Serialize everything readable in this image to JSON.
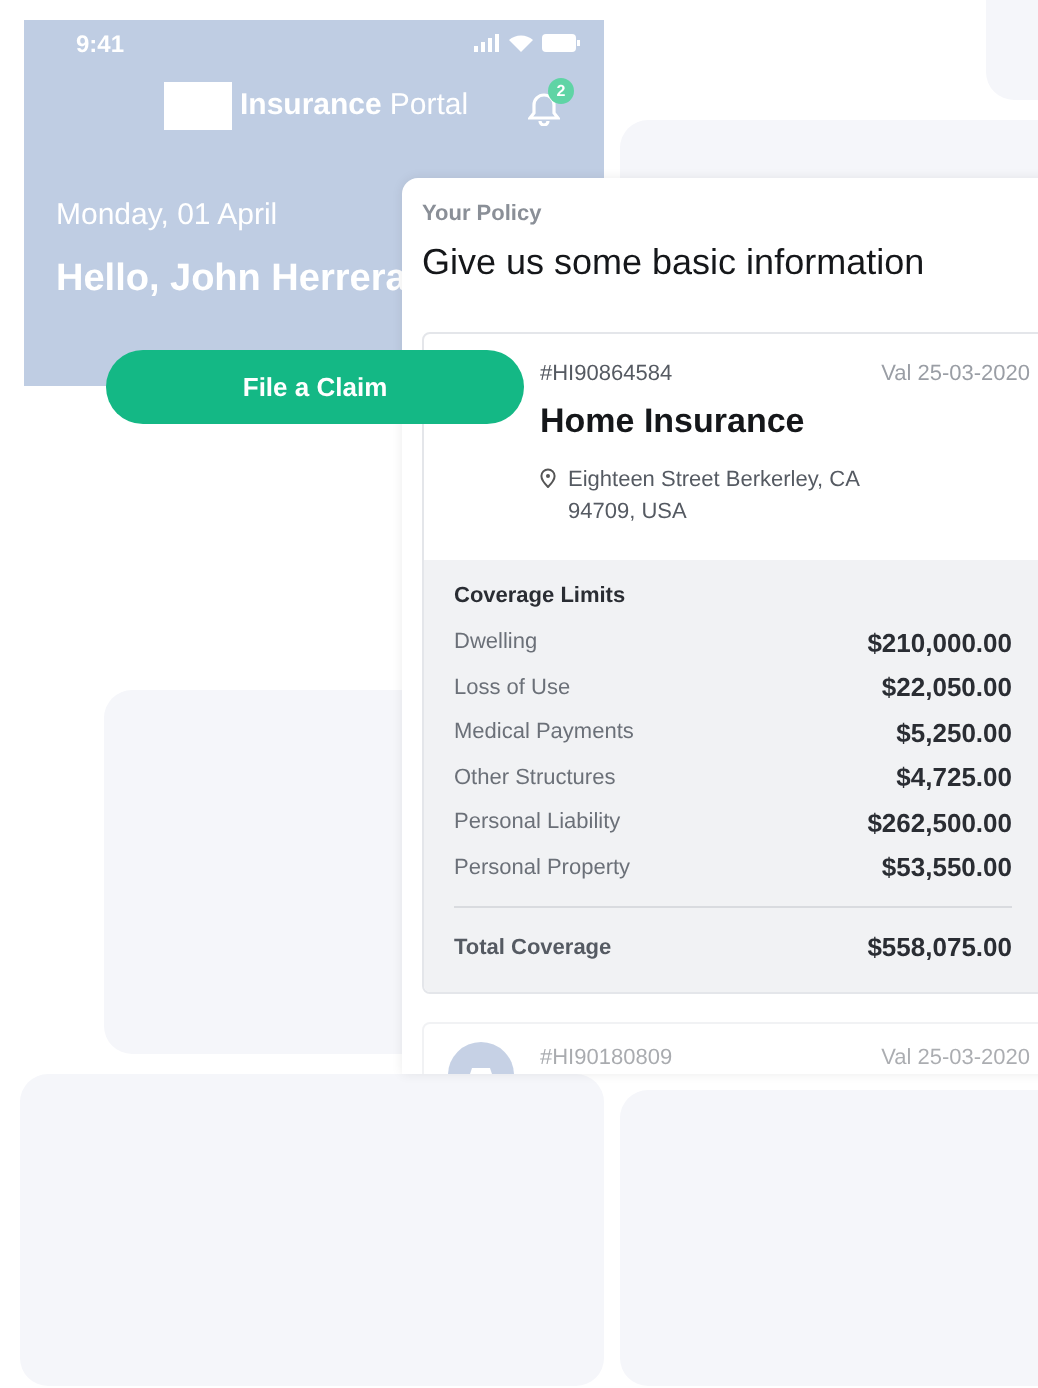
{
  "phone_header": {
    "status_time": "9:41",
    "app_title_bold": "Insurance",
    "app_title_light": "Portal",
    "notification_count": "2",
    "date": "Monday, 01 April",
    "greeting": "Hello, John Herrera"
  },
  "claim_button": {
    "label": "File a Claim"
  },
  "policy_panel": {
    "eyebrow": "Your Policy",
    "heading": "Give us some basic information",
    "policies": [
      {
        "kind": "home",
        "dimmed": false,
        "number": "#HI90864584",
        "valid": "Val 25-03-2020",
        "title": "Home Insurance",
        "address": "Eighteen Street Berkerley, CA 94709, USA",
        "coverage": {
          "title": "Coverage Limits",
          "rows": [
            {
              "label": "Dwelling",
              "amount": "$210,000.00"
            },
            {
              "label": "Loss of Use",
              "amount": "$22,050.00"
            },
            {
              "label": "Medical Payments",
              "amount": "$5,250.00"
            },
            {
              "label": "Other Structures",
              "amount": "$4,725.00"
            },
            {
              "label": "Personal Liability",
              "amount": "$262,500.00"
            },
            {
              "label": "Personal Property",
              "amount": "$53,550.00"
            }
          ],
          "total_label": "Total Coverage",
          "total_amount": "$558,075.00"
        }
      },
      {
        "kind": "car",
        "dimmed": true,
        "number": "#HI90180809",
        "valid": "Val 25-03-2020"
      }
    ]
  }
}
